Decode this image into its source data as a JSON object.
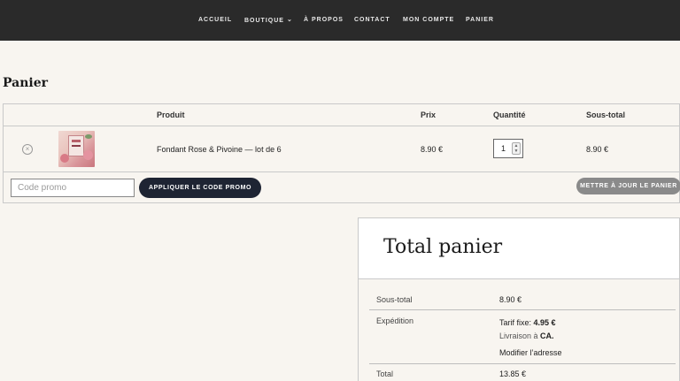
{
  "nav": {
    "items": [
      "ACCUEIL",
      "BOUTIQUE",
      "À PROPOS",
      "CONTACT",
      "MON COMPTE",
      "PANIER"
    ]
  },
  "page": {
    "title": "Panier"
  },
  "cart": {
    "headers": {
      "product": "Produit",
      "price": "Prix",
      "quantity": "Quantité",
      "subtotal": "Sous-total"
    },
    "items": [
      {
        "name": "Fondant Rose & Pivoine — lot de 6",
        "price": "8.90 €",
        "quantity": "1",
        "subtotal": "8.90 €"
      }
    ],
    "remove_symbol": "×",
    "promo_placeholder": "Code promo",
    "apply_label": "APPLIQUER LE CODE PROMO",
    "update_label": "METTRE À JOUR LE PANIER"
  },
  "totals": {
    "title": "Total panier",
    "subtotal_label": "Sous-total",
    "subtotal_value": "8.90 €",
    "shipping_label": "Expédition",
    "shipping_rate_prefix": "Tarif fixe: ",
    "shipping_rate_value": "4.95 €",
    "shipping_dest_prefix": "Livraison à ",
    "shipping_dest_value": "CA.",
    "change_address": "Modifier l’adresse",
    "total_label": "Total",
    "total_value": "13.85 €"
  },
  "colors": {
    "nav_bg": "#2a2a2a",
    "page_bg": "#f8f5f0",
    "primary_button": "#1e2433",
    "secondary_button": "#8a8a8a"
  }
}
